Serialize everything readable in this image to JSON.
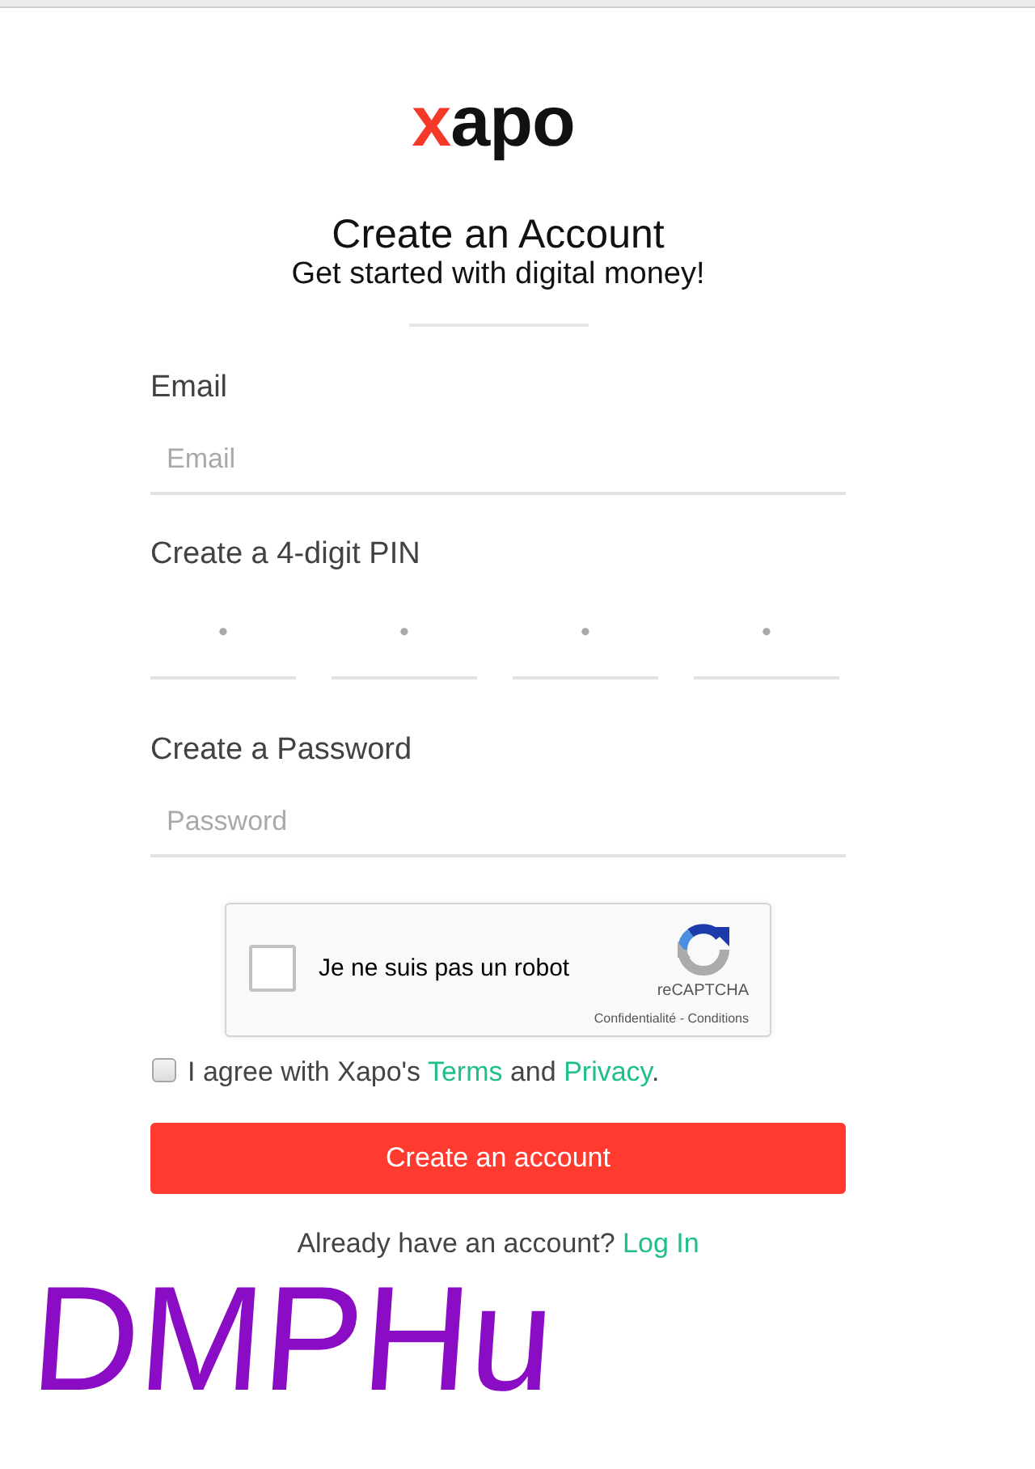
{
  "logo": {
    "accent": "x",
    "text": "apo"
  },
  "heading": {
    "title": "Create an Account",
    "subtitle": "Get started with digital money!"
  },
  "fields": [
    {
      "kind": "email",
      "label": "Email",
      "placeholder": "Email"
    },
    {
      "kind": "pin",
      "label": "Create a 4-digit PIN",
      "digits": [
        {
          "placeholder": "•"
        },
        {
          "placeholder": "•"
        },
        {
          "placeholder": "•"
        },
        {
          "placeholder": "•"
        }
      ]
    },
    {
      "kind": "password",
      "label": "Create a Password",
      "placeholder": "Password"
    }
  ],
  "captcha": {
    "checked": false,
    "label": "Je ne suis pas un robot",
    "brand": "reCAPTCHA",
    "links": "Confidentialité - Conditions"
  },
  "agreement": {
    "checked": false,
    "parts": [
      {
        "kind": "text",
        "text": "I agree with Xapo's "
      },
      {
        "kind": "link",
        "text": "Terms"
      },
      {
        "kind": "text",
        "text": " and "
      },
      {
        "kind": "link",
        "text": "Privacy"
      },
      {
        "kind": "text",
        "text": "."
      }
    ]
  },
  "submit_button": "Create an account",
  "login_prompt": {
    "text": "Already have an account?",
    "link": "Log In"
  },
  "handwritten_note": "DMPHu"
}
